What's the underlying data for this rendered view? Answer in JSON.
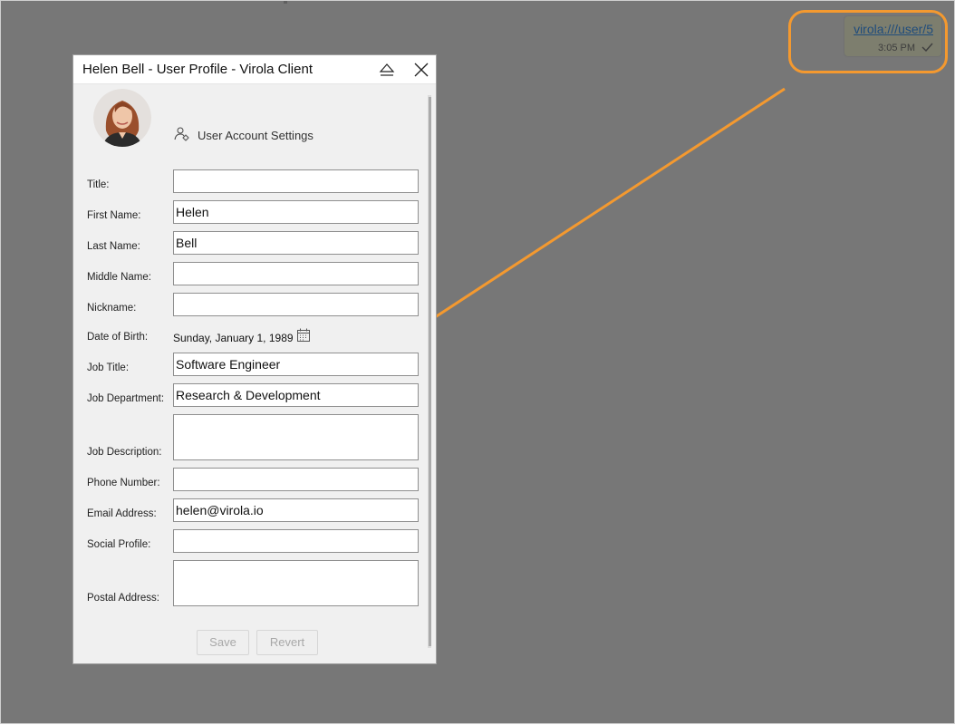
{
  "chat": {
    "link": "virola:///user/5",
    "time": "3:05 PM",
    "highlight_color": "#f4992f"
  },
  "window": {
    "title": "Helen Bell - User Profile - Virola Client",
    "settings_label": "User Account Settings"
  },
  "form": {
    "title_label": "Title:",
    "title_value": "",
    "first_name_label": "First Name:",
    "first_name_value": "Helen",
    "last_name_label": "Last Name:",
    "last_name_value": "Bell",
    "middle_name_label": "Middle Name:",
    "middle_name_value": "",
    "nickname_label": "Nickname:",
    "nickname_value": "",
    "dob_label": "Date of Birth:",
    "dob_value": "Sunday, January 1, 1989",
    "job_title_label": "Job Title:",
    "job_title_value": "Software Engineer",
    "job_department_label": "Job Department:",
    "job_department_value": "Research & Development",
    "job_description_label": "Job Description:",
    "job_description_value": "",
    "phone_label": "Phone Number:",
    "phone_value": "",
    "email_label": "Email Address:",
    "email_value": "helen@virola.io",
    "social_label": "Social Profile:",
    "social_value": "",
    "postal_label": "Postal Address:",
    "postal_value": ""
  },
  "buttons": {
    "save": "Save",
    "revert": "Revert"
  }
}
